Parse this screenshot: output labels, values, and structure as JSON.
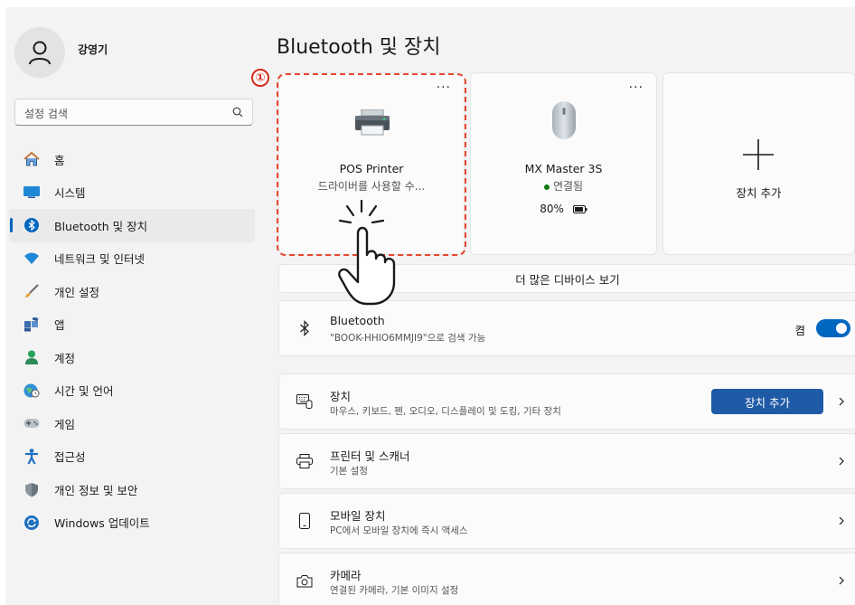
{
  "user": {
    "name": "강영기"
  },
  "search": {
    "placeholder": "설정 검색"
  },
  "nav": [
    {
      "label": "홈",
      "icon": "home-icon"
    },
    {
      "label": "시스템",
      "icon": "system-icon"
    },
    {
      "label": "Bluetooth 및 장치",
      "icon": "bluetooth-icon",
      "active": true
    },
    {
      "label": "네트워크 및 인터넷",
      "icon": "wifi-icon"
    },
    {
      "label": "개인 설정",
      "icon": "brush-icon"
    },
    {
      "label": "앱",
      "icon": "apps-icon"
    },
    {
      "label": "계정",
      "icon": "account-icon"
    },
    {
      "label": "시간 및 언어",
      "icon": "globe-clock-icon"
    },
    {
      "label": "게임",
      "icon": "gamepad-icon"
    },
    {
      "label": "접근성",
      "icon": "accessibility-icon"
    },
    {
      "label": "개인 정보 및 보안",
      "icon": "shield-icon"
    },
    {
      "label": "Windows 업데이트",
      "icon": "update-icon"
    }
  ],
  "page": {
    "title": "Bluetooth 및 장치"
  },
  "annotation": {
    "step": "①"
  },
  "cards": [
    {
      "name": "POS Printer",
      "sub": "드라이버를 사용할 수...",
      "dots": "..."
    },
    {
      "name": "MX Master 3S",
      "status": "연결됨",
      "battery": "80%",
      "dots": "..."
    },
    {
      "label": "장치 추가"
    }
  ],
  "more_devices": "더 많은 디바이스 보기",
  "rows": {
    "bluetooth": {
      "title": "Bluetooth",
      "desc": "\"BOOK-HHIO6MMJI9\"으로 검색 가능",
      "toggle_label": "켬"
    },
    "devices": {
      "title": "장치",
      "desc": "마우스, 키보드, 펜, 오디오, 디스플레이 및 도킹, 기타 장치",
      "button": "장치 추가"
    },
    "printers": {
      "title": "프린터 및 스캐너",
      "desc": "기본 설정"
    },
    "mobile": {
      "title": "모바일 장치",
      "desc": "PC에서 모바일 장치에 즉시 액세스"
    },
    "camera": {
      "title": "카메라",
      "desc": "연결된 카메라, 기본 이미지 설정"
    }
  },
  "colors": {
    "accent": "#0067c0",
    "highlight": "#e8452e",
    "connected": "#0f7b0f"
  }
}
